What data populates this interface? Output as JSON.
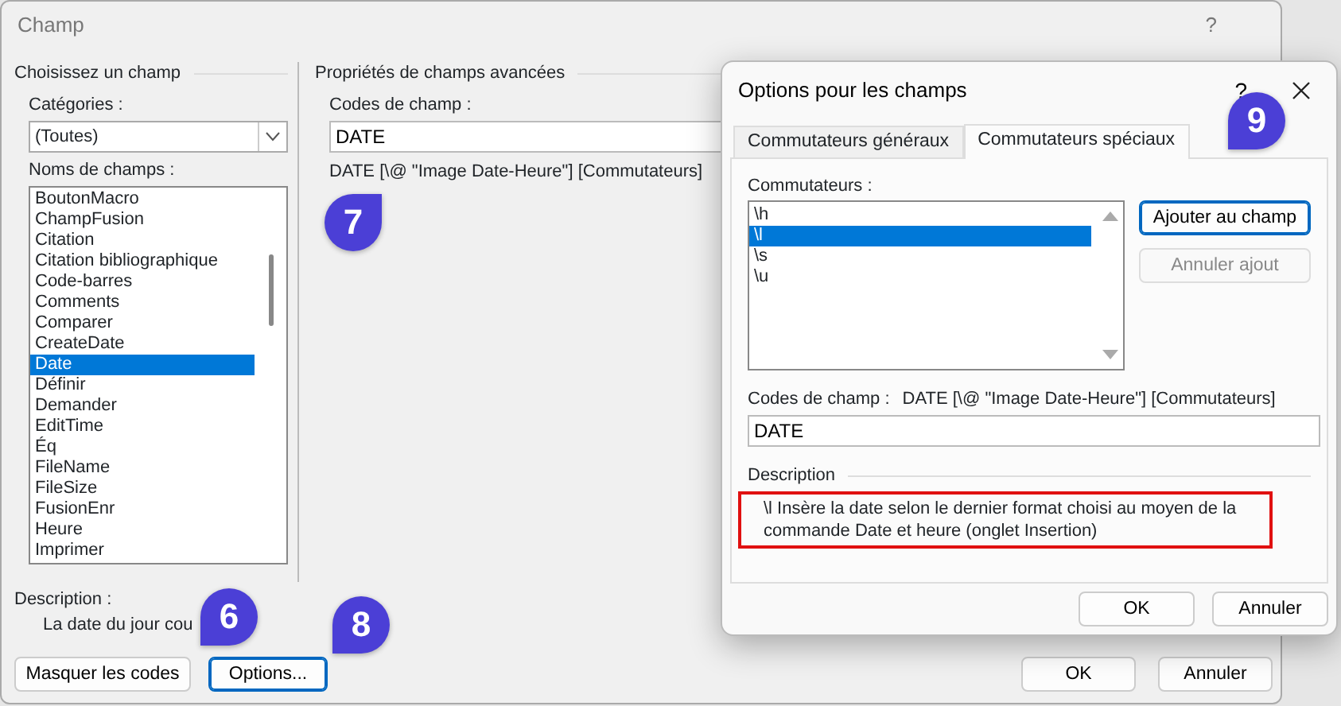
{
  "main_dialog": {
    "title": "Champ",
    "help": "?",
    "choose_group": {
      "legend": "Choisissez un champ",
      "categories_label": "Catégories :",
      "categories_value": "(Toutes)",
      "names_label": "Noms de champs :",
      "field_names": [
        {
          "label": "BoutonMacro",
          "selected": false
        },
        {
          "label": "ChampFusion",
          "selected": false
        },
        {
          "label": "Citation",
          "selected": false
        },
        {
          "label": "Citation bibliographique",
          "selected": false
        },
        {
          "label": "Code-barres",
          "selected": false
        },
        {
          "label": "Comments",
          "selected": false
        },
        {
          "label": "Comparer",
          "selected": false
        },
        {
          "label": "CreateDate",
          "selected": false
        },
        {
          "label": "Date",
          "selected": true
        },
        {
          "label": "Définir",
          "selected": false
        },
        {
          "label": "Demander",
          "selected": false
        },
        {
          "label": "EditTime",
          "selected": false
        },
        {
          "label": "Éq",
          "selected": false
        },
        {
          "label": "FileName",
          "selected": false
        },
        {
          "label": "FileSize",
          "selected": false
        },
        {
          "label": "FusionEnr",
          "selected": false
        },
        {
          "label": "Heure",
          "selected": false
        },
        {
          "label": "Imprimer",
          "selected": false
        }
      ]
    },
    "advanced_group": {
      "legend": "Propriétés de champs avancées",
      "codes_label": "Codes de champ :",
      "codes_value": "DATE",
      "syntax": "DATE [\\@ \"Image Date-Heure\"] [Commutateurs]"
    },
    "description_label": "Description :",
    "description_text": "La date du jour cou",
    "buttons": [
      {
        "label": "Masquer les codes",
        "focused": false
      },
      {
        "label": "Options...",
        "focused": true
      }
    ],
    "footer_buttons": [
      {
        "label": "OK"
      },
      {
        "label": "Annuler"
      }
    ]
  },
  "options_dialog": {
    "title": "Options pour les champs",
    "help": "?",
    "tabs": [
      {
        "label": "Commutateurs généraux",
        "selected": false
      },
      {
        "label": "Commutateurs spéciaux",
        "selected": true
      }
    ],
    "switches_label": "Commutateurs :",
    "switches": [
      {
        "label": "\\h",
        "selected": false
      },
      {
        "label": "\\l",
        "selected": true
      },
      {
        "label": "\\s",
        "selected": false
      },
      {
        "label": "\\u",
        "selected": false
      }
    ],
    "side_buttons": [
      {
        "label": "Ajouter au champ",
        "default": true,
        "disabled": false
      },
      {
        "label": "Annuler ajout",
        "default": false,
        "disabled": true
      }
    ],
    "codes_label": "Codes de champ :",
    "codes_syntax": "DATE [\\@ \"Image Date-Heure\"] [Commutateurs]",
    "codes_value": "DATE",
    "description_legend": "Description",
    "description_text": "\\l Insère la date selon le dernier format choisi au moyen de la commande Date et heure (onglet Insertion)",
    "description_highlighted": true,
    "buttons": [
      {
        "label": "OK"
      },
      {
        "label": "Annuler"
      }
    ]
  },
  "callouts": [
    {
      "label": "7"
    },
    {
      "label": "6"
    },
    {
      "label": "8"
    },
    {
      "label": "9"
    }
  ]
}
